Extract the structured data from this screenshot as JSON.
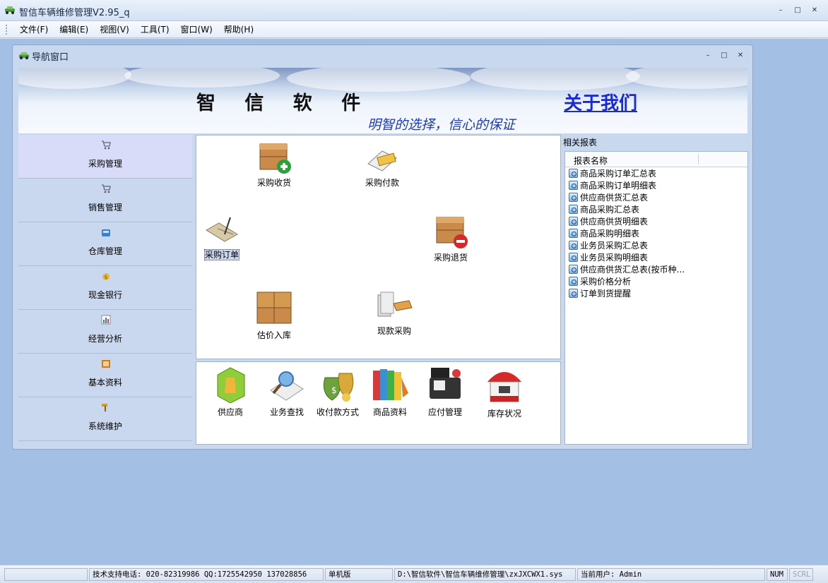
{
  "window": {
    "title": "智信车辆维修管理V2.95_q"
  },
  "menu": [
    {
      "label": "文件(F)"
    },
    {
      "label": "编辑(E)"
    },
    {
      "label": "视图(V)"
    },
    {
      "label": "工具(T)"
    },
    {
      "label": "窗口(W)"
    },
    {
      "label": "帮助(H)"
    }
  ],
  "child": {
    "title": "导航窗口"
  },
  "banner": {
    "brand": "智 信 软 件",
    "about": "关于我们",
    "slogan": "明智的选择，信心的保证"
  },
  "nav": [
    {
      "label": "采购管理",
      "icon": "cart-icon",
      "active": true
    },
    {
      "label": "销售管理",
      "icon": "cart-icon"
    },
    {
      "label": "仓库管理",
      "icon": "warehouse-icon"
    },
    {
      "label": "现金银行",
      "icon": "money-icon"
    },
    {
      "label": "经营分析",
      "icon": "chart-icon"
    },
    {
      "label": "基本资料",
      "icon": "folder-icon"
    },
    {
      "label": "系统维护",
      "icon": "hammer-icon"
    }
  ],
  "center_tiles": [
    {
      "label": "采购收货",
      "icon": "box-add-icon"
    },
    {
      "label": "采购付款",
      "icon": "card-payment-icon"
    },
    {
      "label": "采购订单",
      "icon": "order-pen-icon",
      "selected": true
    },
    {
      "label": "采购退货",
      "icon": "box-remove-icon"
    },
    {
      "label": "估价入库",
      "icon": "boxes-icon"
    },
    {
      "label": "现款采购",
      "icon": "cash-hand-icon"
    }
  ],
  "bottom_tiles": [
    {
      "label": "供应商",
      "icon": "supplier-icon"
    },
    {
      "label": "业务查找",
      "icon": "magnifier-icon"
    },
    {
      "label": "收付款方式",
      "icon": "money-bag-icon"
    },
    {
      "label": "商品资料",
      "icon": "books-icon"
    },
    {
      "label": "应付管理",
      "icon": "cash-register-icon"
    },
    {
      "label": "库存状况",
      "icon": "store-icon"
    }
  ],
  "reports": {
    "heading": "相关报表",
    "column": "报表名称",
    "items": [
      "商品采购订单汇总表",
      "商品采购订单明细表",
      "供应商供货汇总表",
      "商品采购汇总表",
      "供应商供货明细表",
      "商品采购明细表",
      "业务员采购汇总表",
      "业务员采购明细表",
      "供应商供货汇总表(按币种...",
      "采购价格分析",
      "订单到货提醒"
    ]
  },
  "status": {
    "support": "技术支持电话: 020-82319986 QQ:1725542950 137028856",
    "mode": "单机版",
    "path": "D:\\智信软件\\智信车辆维修管理\\zxJXCWX1.sys",
    "user": "当前用户: Admin",
    "num": "NUM",
    "scrl": "SCRL"
  }
}
